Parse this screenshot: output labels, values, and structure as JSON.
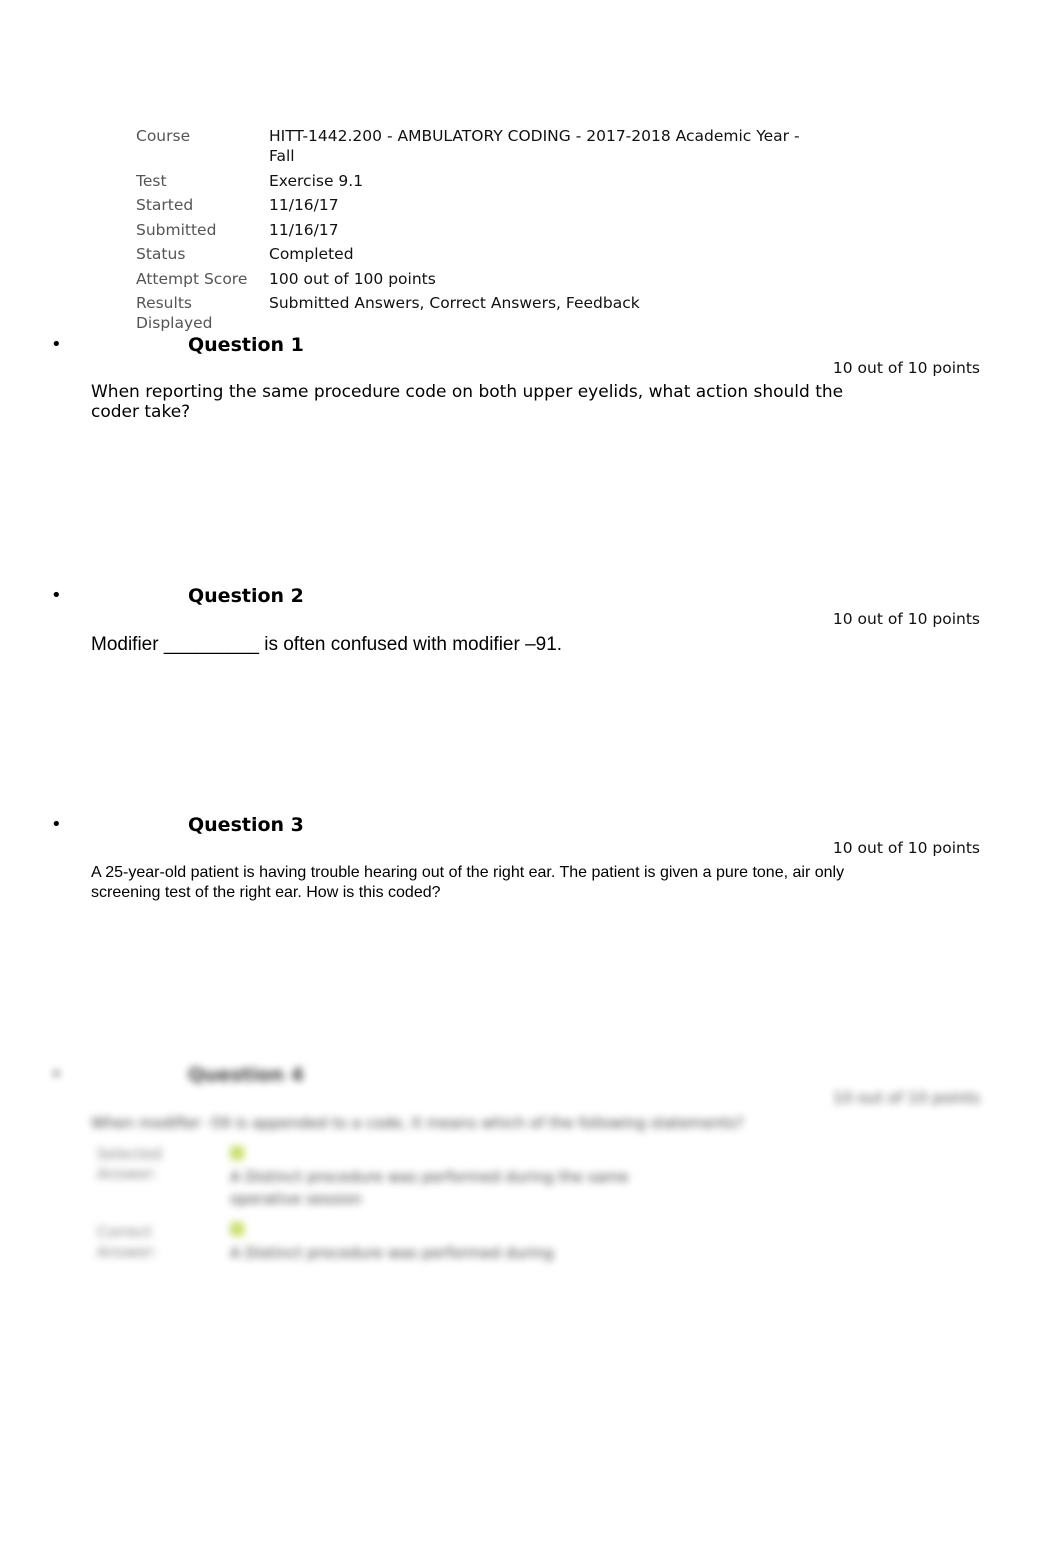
{
  "summary": [
    {
      "label": "Course",
      "value": "HITT-1442.200 - AMBULATORY CODING - 2017-2018 Academic Year - Fall"
    },
    {
      "label": "Test",
      "value": "Exercise 9.1"
    },
    {
      "label": "Started",
      "value": "11/16/17"
    },
    {
      "label": "Submitted",
      "value": "11/16/17"
    },
    {
      "label": "Status",
      "value": "Completed"
    },
    {
      "label": "Attempt Score",
      "value": "100 out of 100 points"
    },
    {
      "label": "Results Displayed",
      "value": "Submitted Answers, Correct Answers, Feedback"
    }
  ],
  "questions": [
    {
      "bullet": "•",
      "title": "Question 1",
      "points": "10 out of 10 points",
      "text": "When reporting the same procedure code on both upper eyelids, what action should the coder take?"
    },
    {
      "bullet": "•",
      "title": "Question 2",
      "points": "10 out of 10 points",
      "text": "Modifier _________ is often confused with modifier –91."
    },
    {
      "bullet": "•",
      "title": "Question 3",
      "points": "10 out of 10 points",
      "text": "A 25-year-old patient is having trouble hearing out of the right ear. The patient is given a pure tone, air only screening test of the right ear. How is this coded?"
    },
    {
      "bullet": "•",
      "title": "Question 4",
      "points": "10 out of 10 points",
      "text": "When modifier -59 is appended to a code, it means which of the following statements?",
      "answers": [
        {
          "label": "Selected Answer:",
          "value": "A Distinct procedure was performed during the same operative session"
        },
        {
          "label": "Correct Answer:",
          "value": "A Distinct procedure was performed during"
        }
      ]
    }
  ],
  "colors": {
    "label": "#555555",
    "check": "#b5d335"
  }
}
